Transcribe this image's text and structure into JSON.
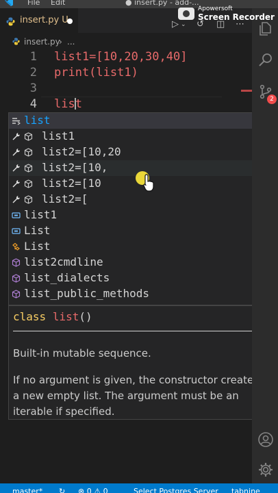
{
  "menu": {
    "file": "File",
    "edit": "Edit",
    "window_title": "● insert.py - add-..."
  },
  "recorder": {
    "brand": "Apowersoft",
    "name": "Screen Recorder"
  },
  "tab": {
    "label": "insert.py",
    "modified_flag": "U"
  },
  "breadcrumb": {
    "file": "insert.py",
    "separator": "›",
    "more": "..."
  },
  "editor": {
    "lines": [
      {
        "num": "1",
        "code": "list1=[10,20,30,40]"
      },
      {
        "num": "2",
        "code": "print(list1)"
      },
      {
        "num": "3",
        "code": ""
      },
      {
        "num": "4",
        "code_before_cursor": "lis",
        "code_after_cursor": "t"
      }
    ]
  },
  "suggestions": [
    {
      "kind": "keyword",
      "icon": "keyword-icon",
      "label": "list"
    },
    {
      "kind": "snippet",
      "icon": "wrench-cube-icon",
      "label": "list1"
    },
    {
      "kind": "snippet",
      "icon": "wrench-cube-icon",
      "label": "list2=[10,20"
    },
    {
      "kind": "snippet",
      "icon": "wrench-cube-icon",
      "label": "list2=[10,"
    },
    {
      "kind": "snippet",
      "icon": "wrench-cube-icon",
      "label": "list2=[10"
    },
    {
      "kind": "snippet",
      "icon": "wrench-cube-icon",
      "label": "list2=["
    },
    {
      "kind": "variable",
      "icon": "variable-icon",
      "label": "list1"
    },
    {
      "kind": "variable",
      "icon": "variable-icon",
      "label": "List"
    },
    {
      "kind": "class",
      "icon": "class-icon",
      "label": "List"
    },
    {
      "kind": "module",
      "icon": "module-icon",
      "label": "list2cmdline"
    },
    {
      "kind": "module",
      "icon": "module-icon",
      "label": "list_dialects"
    },
    {
      "kind": "module",
      "icon": "module-icon",
      "label": "list_public_methods"
    }
  ],
  "docs": {
    "keyword": "class",
    "name": "list",
    "parens": "()",
    "summary": "Built-in mutable sequence.",
    "detail": "If no argument is given, the constructor creates a new empty list. The argument must be an iterable if specified."
  },
  "activity": {
    "scm_badge": "2"
  },
  "status": {
    "branch": "master*",
    "problems": "⊗ 0 ⚠ 0",
    "server": "Select Postgres Server",
    "tabnine": "tabnine"
  },
  "colors": {
    "editor_bg": "#1e1e1e",
    "activity_bg": "#2c2c2c",
    "status_bg": "#007acc",
    "code_text": "#e86a6a",
    "match_blue": "#18a3ff",
    "tab_label": "#e2c08d"
  }
}
